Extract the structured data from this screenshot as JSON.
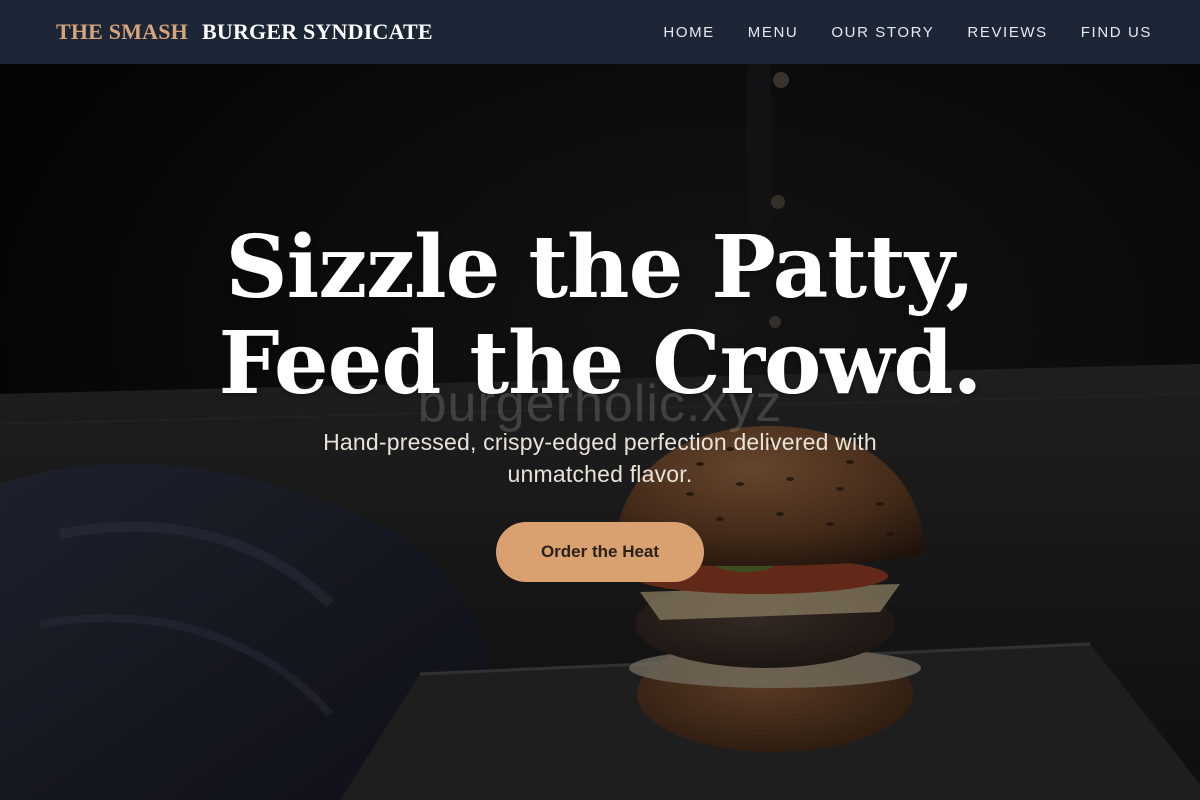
{
  "brand": {
    "part1": "THE SMASH",
    "part2": "BURGER SYNDICATE"
  },
  "nav": {
    "items": [
      "HOME",
      "MENU",
      "OUR STORY",
      "REVIEWS",
      "FIND US"
    ]
  },
  "hero": {
    "title_line1": "Sizzle the Patty,",
    "title_line2": "Feed the Crowd.",
    "watermark": "burgerholic.xyz",
    "subtitle": "Hand-pressed, crispy-edged perfection delivered with unmatched flavor.",
    "cta_label": "Order the Heat"
  },
  "colors": {
    "nav_bg": "#1d2636",
    "accent": "#d9a070",
    "brand_gold": "#d6a47a"
  }
}
